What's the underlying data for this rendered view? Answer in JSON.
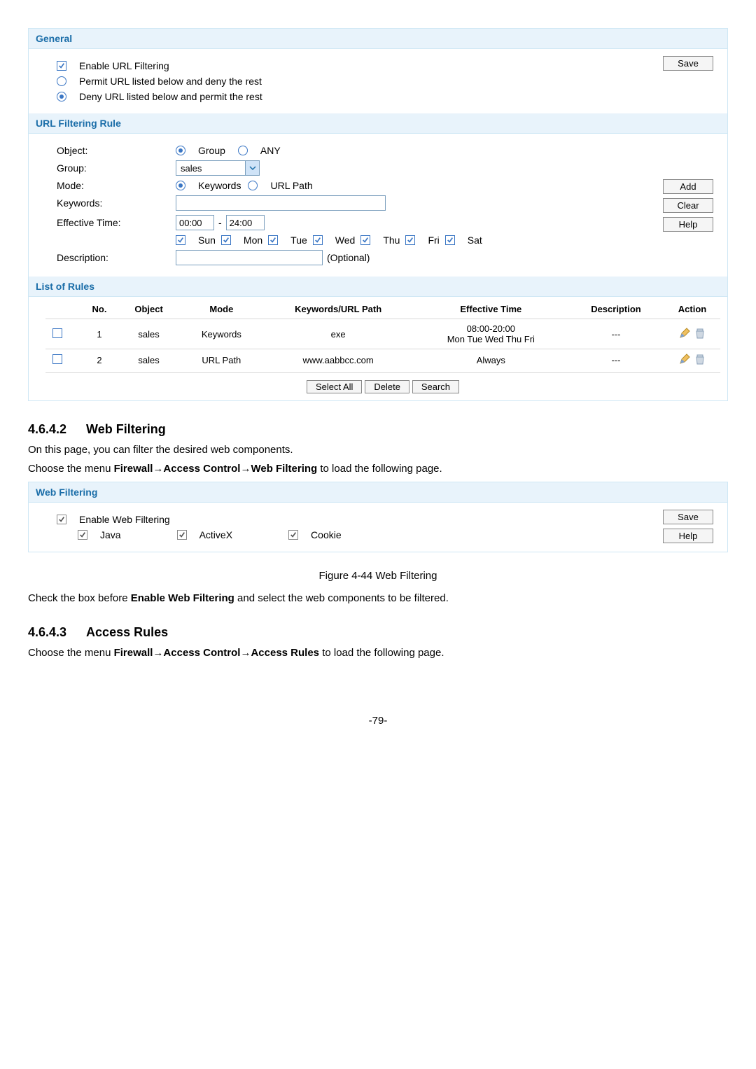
{
  "url_filter_panel": {
    "sections": {
      "general": {
        "title": "General",
        "enable_label": "Enable URL Filtering",
        "enable_checked": true,
        "mode_permit": "Permit URL listed below and deny the rest",
        "mode_deny": "Deny URL listed below and permit the rest",
        "mode_selected": "deny",
        "save_btn": "Save"
      },
      "rule": {
        "title": "URL Filtering Rule",
        "object_label": "Object:",
        "object_group": "Group",
        "object_any": "ANY",
        "object_selected": "group",
        "group_label": "Group:",
        "group_value": "sales",
        "mode_label": "Mode:",
        "mode_keywords": "Keywords",
        "mode_urlpath": "URL Path",
        "mode_selected": "keywords",
        "keywords_label": "Keywords:",
        "keywords_value": "",
        "eff_label": "Effective Time:",
        "eff_from": "00:00",
        "eff_to": "24:00",
        "days": {
          "sun": "Sun",
          "mon": "Mon",
          "tue": "Tue",
          "wed": "Wed",
          "thu": "Thu",
          "fri": "Fri",
          "sat": "Sat"
        },
        "days_checked": [
          "sun",
          "mon",
          "tue",
          "wed",
          "thu",
          "fri",
          "sat"
        ],
        "desc_label": "Description:",
        "desc_hint": "(Optional)",
        "add_btn": "Add",
        "clear_btn": "Clear",
        "help_btn": "Help"
      },
      "list": {
        "title": "List of Rules",
        "cols": {
          "no": "No.",
          "object": "Object",
          "mode": "Mode",
          "kw": "Keywords/URL Path",
          "eff": "Effective Time",
          "desc": "Description",
          "action": "Action"
        },
        "rows": [
          {
            "no": "1",
            "object": "sales",
            "mode": "Keywords",
            "kw": "exe",
            "eff_line1": "08:00-20:00",
            "eff_line2": "Mon Tue Wed Thu Fri",
            "desc": "---"
          },
          {
            "no": "2",
            "object": "sales",
            "mode": "URL Path",
            "kw": "www.aabbcc.com",
            "eff_line1": "Always",
            "eff_line2": "",
            "desc": "---"
          }
        ],
        "select_all_btn": "Select All",
        "delete_btn": "Delete",
        "search_btn": "Search"
      }
    }
  },
  "doc": {
    "h_46_4_2_num": "4.6.4.2",
    "h_46_4_2_title": "Web Filtering",
    "p1": "On this page, you can filter the desired web components.",
    "p2_pre": "Choose the menu ",
    "p2_bold": "Firewall→Access Control→Web Filtering",
    "p2_post": " to load the following page.",
    "fig_caption": "Figure 4-44 Web Filtering",
    "p3_pre": "Check the box before ",
    "p3_bold": "Enable Web Filtering",
    "p3_post": " and select the web components to be filtered.",
    "h_46_4_3_num": "4.6.4.3",
    "h_46_4_3_title": "Access Rules",
    "p4_pre": "Choose the menu ",
    "p4_bold": "Firewall→Access Control→Access Rules",
    "p4_post": " to load the following page.",
    "page_number": "-79-"
  },
  "web_filter_panel": {
    "title": "Web Filtering",
    "enable_label": "Enable Web Filtering",
    "java": "Java",
    "activex": "ActiveX",
    "cookie": "Cookie",
    "save_btn": "Save",
    "help_btn": "Help"
  }
}
